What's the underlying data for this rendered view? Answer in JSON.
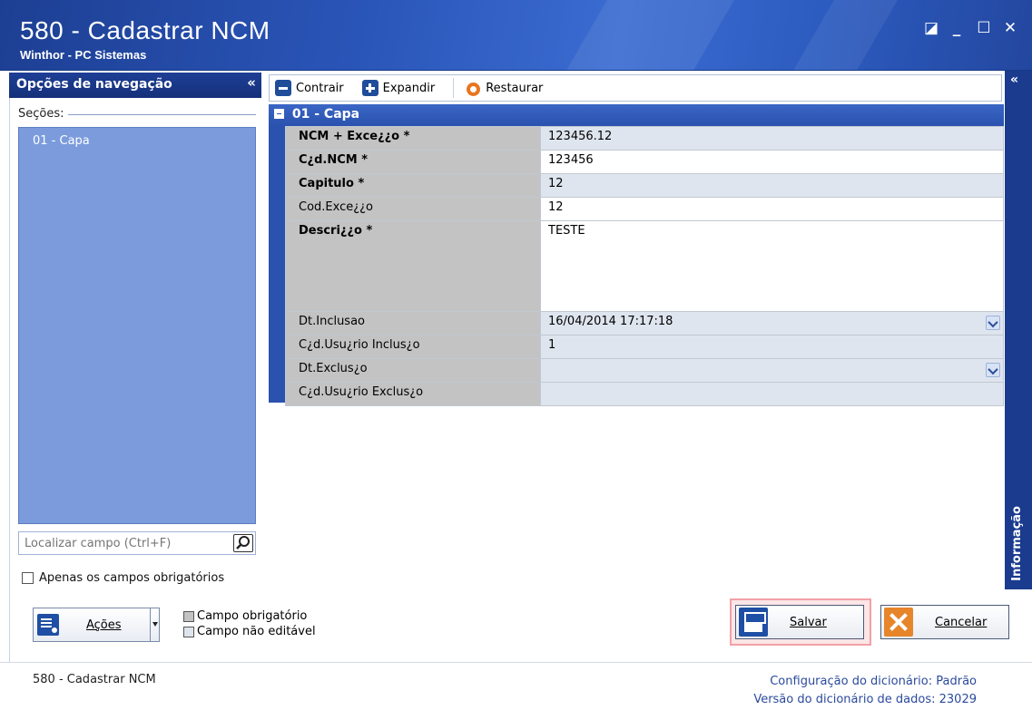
{
  "window": {
    "title": "580 - Cadastrar  NCM",
    "subtitle": "Winthor - PC Sistemas",
    "controls": [
      "restore",
      "minimize",
      "maximize",
      "close"
    ]
  },
  "nav": {
    "header": "Opções de navegação",
    "collapse": "«",
    "sections_label": "Seções:",
    "sections": [
      "01 - Capa"
    ],
    "search_placeholder": "Localizar campo (Ctrl+F)",
    "only_required_label": "Apenas os campos obrigatórios"
  },
  "toolbar": {
    "collapse_label": "Contrair",
    "expand_label": "Expandir",
    "restore_label": "Restaurar"
  },
  "info_tab": {
    "collapse": "«",
    "label": "Informação"
  },
  "form": {
    "section_title": "01 - Capa",
    "fields": [
      {
        "label": "NCM + Exce¿¿o *",
        "value": "123456.12",
        "required": true
      },
      {
        "label": "C¿d.NCM *",
        "value": "123456",
        "required": true
      },
      {
        "label": "Capitulo *",
        "value": "12",
        "required": true
      },
      {
        "label": "Cod.Exce¿¿o",
        "value": "12",
        "required": false
      },
      {
        "label": "Descri¿¿o *",
        "value": "TESTE",
        "required": true
      },
      {
        "label": "Dt.Inclusao",
        "value": "16/04/2014 17:17:18",
        "required": false
      },
      {
        "label": "C¿d.Usu¿rio Inclus¿o",
        "value": "1",
        "required": false
      },
      {
        "label": "Dt.Exclus¿o",
        "value": "",
        "required": false
      },
      {
        "label": "C¿d.Usu¿rio Exclus¿o",
        "value": "",
        "required": false
      }
    ]
  },
  "actions": {
    "acoes_label": "Ações",
    "legend_required": "Campo obrigatório",
    "legend_noneditable": "Campo não editável",
    "save_label": "Salvar",
    "cancel_label": "Cancelar"
  },
  "status": {
    "left": "580 - Cadastrar  NCM",
    "dict_config_label": "Configuração do dicionário:",
    "dict_config_value": "Padrão",
    "dict_version_label": "Versão do dicionário de dados:",
    "dict_version_value": "23029"
  },
  "colors": {
    "title_bar": "#2a55b8",
    "nav_header": "#1e3f96",
    "sections_bg": "#7b9bdc",
    "section_bar": "#2a52ae",
    "label_cell": "#c3c3c3",
    "readonly_cell": "#dfe5ef",
    "save_highlight": "#f2a1a6",
    "status_text": "#2b4a9c"
  }
}
